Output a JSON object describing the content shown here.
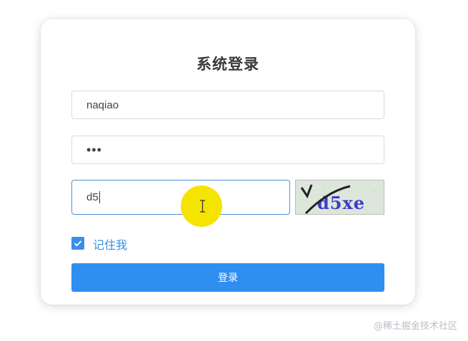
{
  "title": "系统登录",
  "username": {
    "value": "naqiao"
  },
  "password": {
    "value": "•••"
  },
  "captcha": {
    "value": "d5",
    "image_text": "d5xe"
  },
  "remember": {
    "label": "记住我",
    "checked": true
  },
  "login_button": {
    "label": "登录"
  },
  "watermark": "@稀土掘金技术社区",
  "colors": {
    "accent": "#2f8ff0",
    "checkbox": "#3a8ee6",
    "highlight": "#f5e300"
  }
}
